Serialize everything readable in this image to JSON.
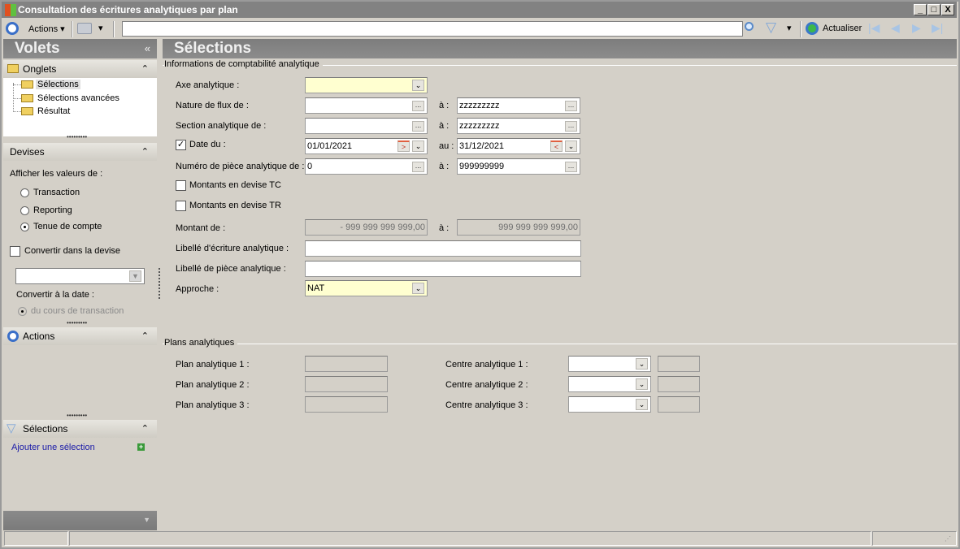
{
  "window": {
    "title": "Consultation des écritures analytiques par plan",
    "minimize": "_",
    "maximize": "□",
    "close": "X"
  },
  "toolbar": {
    "actions_label": "Actions",
    "search_value": "",
    "refresh_label": "Actualiser"
  },
  "sidebar": {
    "title": "Volets",
    "collapse": "«",
    "onglets": {
      "title": "Onglets",
      "items": [
        {
          "label": "Sélections"
        },
        {
          "label": "Sélections avancées"
        },
        {
          "label": "Résultat"
        }
      ]
    },
    "devises": {
      "title": "Devises",
      "show_values_label": "Afficher les valeurs de :",
      "radios": [
        {
          "label": "Transaction",
          "checked": false
        },
        {
          "label": "Reporting",
          "checked": false
        },
        {
          "label": "Tenue de compte",
          "checked": true
        }
      ],
      "convert_label": "Convertir dans la devise",
      "convert_date_label": "Convertir à la date :",
      "rate_label": "du cours de transaction"
    },
    "actions": {
      "title": "Actions"
    },
    "selections": {
      "title": "Sélections",
      "add_link": "Ajouter une sélection"
    }
  },
  "main": {
    "title": "Sélections",
    "group1": "Informations de comptabilité analytique",
    "axe_label": "Axe analytique :",
    "axe_value": "",
    "nature_label": "Nature de flux de :",
    "nature_from": "",
    "nature_to": "zzzzzzzzz",
    "section_label": "Section analytique de :",
    "section_from": "",
    "section_to": "zzzzzzzzz",
    "date_label": "Date du :",
    "date_checked": true,
    "date_from": "01/01/2021",
    "date_to_label": "au :",
    "date_to": "31/12/2021",
    "piece_label": "Numéro de pièce analytique de :",
    "piece_from": "0",
    "piece_to": "999999999",
    "tc_label": "Montants en devise TC",
    "tr_label": "Montants en devise TR",
    "montant_label": "Montant de :",
    "montant_from": "- 999 999 999 999,00",
    "montant_to": "999 999 999 999,00",
    "to_label": "à :",
    "libelle_ecr_label": "Libellé d'écriture analytique :",
    "libelle_ecr": "",
    "libelle_piece_label": "Libellé de pièce analytique :",
    "libelle_piece": "",
    "approche_label": "Approche :",
    "approche_value": "NAT",
    "group2": "Plans analytiques",
    "plans": [
      {
        "plan_label": "Plan analytique 1 :",
        "centre_label": "Centre analytique 1 :"
      },
      {
        "plan_label": "Plan analytique 2 :",
        "centre_label": "Centre analytique 2 :"
      },
      {
        "plan_label": "Plan analytique 3 :",
        "centre_label": "Centre analytique 3 :"
      }
    ]
  }
}
